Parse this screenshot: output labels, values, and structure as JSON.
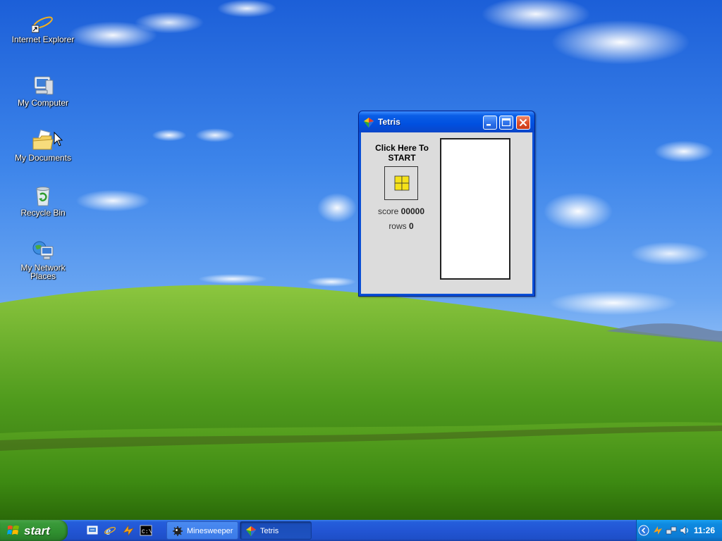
{
  "desktop": {
    "icons": [
      {
        "label": "Internet Explorer",
        "icon": "internet-explorer-icon"
      },
      {
        "label": "My Computer",
        "icon": "my-computer-icon"
      },
      {
        "label": "My Documents",
        "icon": "my-documents-icon"
      },
      {
        "label": "Recycle Bin",
        "icon": "recycle-bin-icon"
      },
      {
        "label": "My Network Places",
        "icon": "network-places-icon"
      }
    ]
  },
  "window": {
    "title": "Tetris",
    "start_label": "Click Here To START",
    "score_label": "score",
    "score_value": "00000",
    "rows_label": "rows",
    "rows_value": "0"
  },
  "taskbar": {
    "start_label": "start",
    "quick_launch": [
      "show-desktop-icon",
      "internet-explorer-icon",
      "winamp-icon",
      "command-prompt-icon"
    ],
    "tasks": [
      {
        "label": "Minesweeper",
        "icon": "minesweeper-icon",
        "active": false
      },
      {
        "label": "Tetris",
        "icon": "tetris-icon",
        "active": true
      }
    ],
    "tray_icons": [
      "tray-expand-icon",
      "tray-app-icon",
      "network-icon",
      "volume-icon"
    ],
    "clock": "11:26"
  },
  "colors": {
    "titlebar": "#0050e0",
    "taskbar": "#245edb",
    "start_button": "#3a9a3a",
    "tray": "#0d7bd4",
    "window_client": "#dcdcdc"
  }
}
